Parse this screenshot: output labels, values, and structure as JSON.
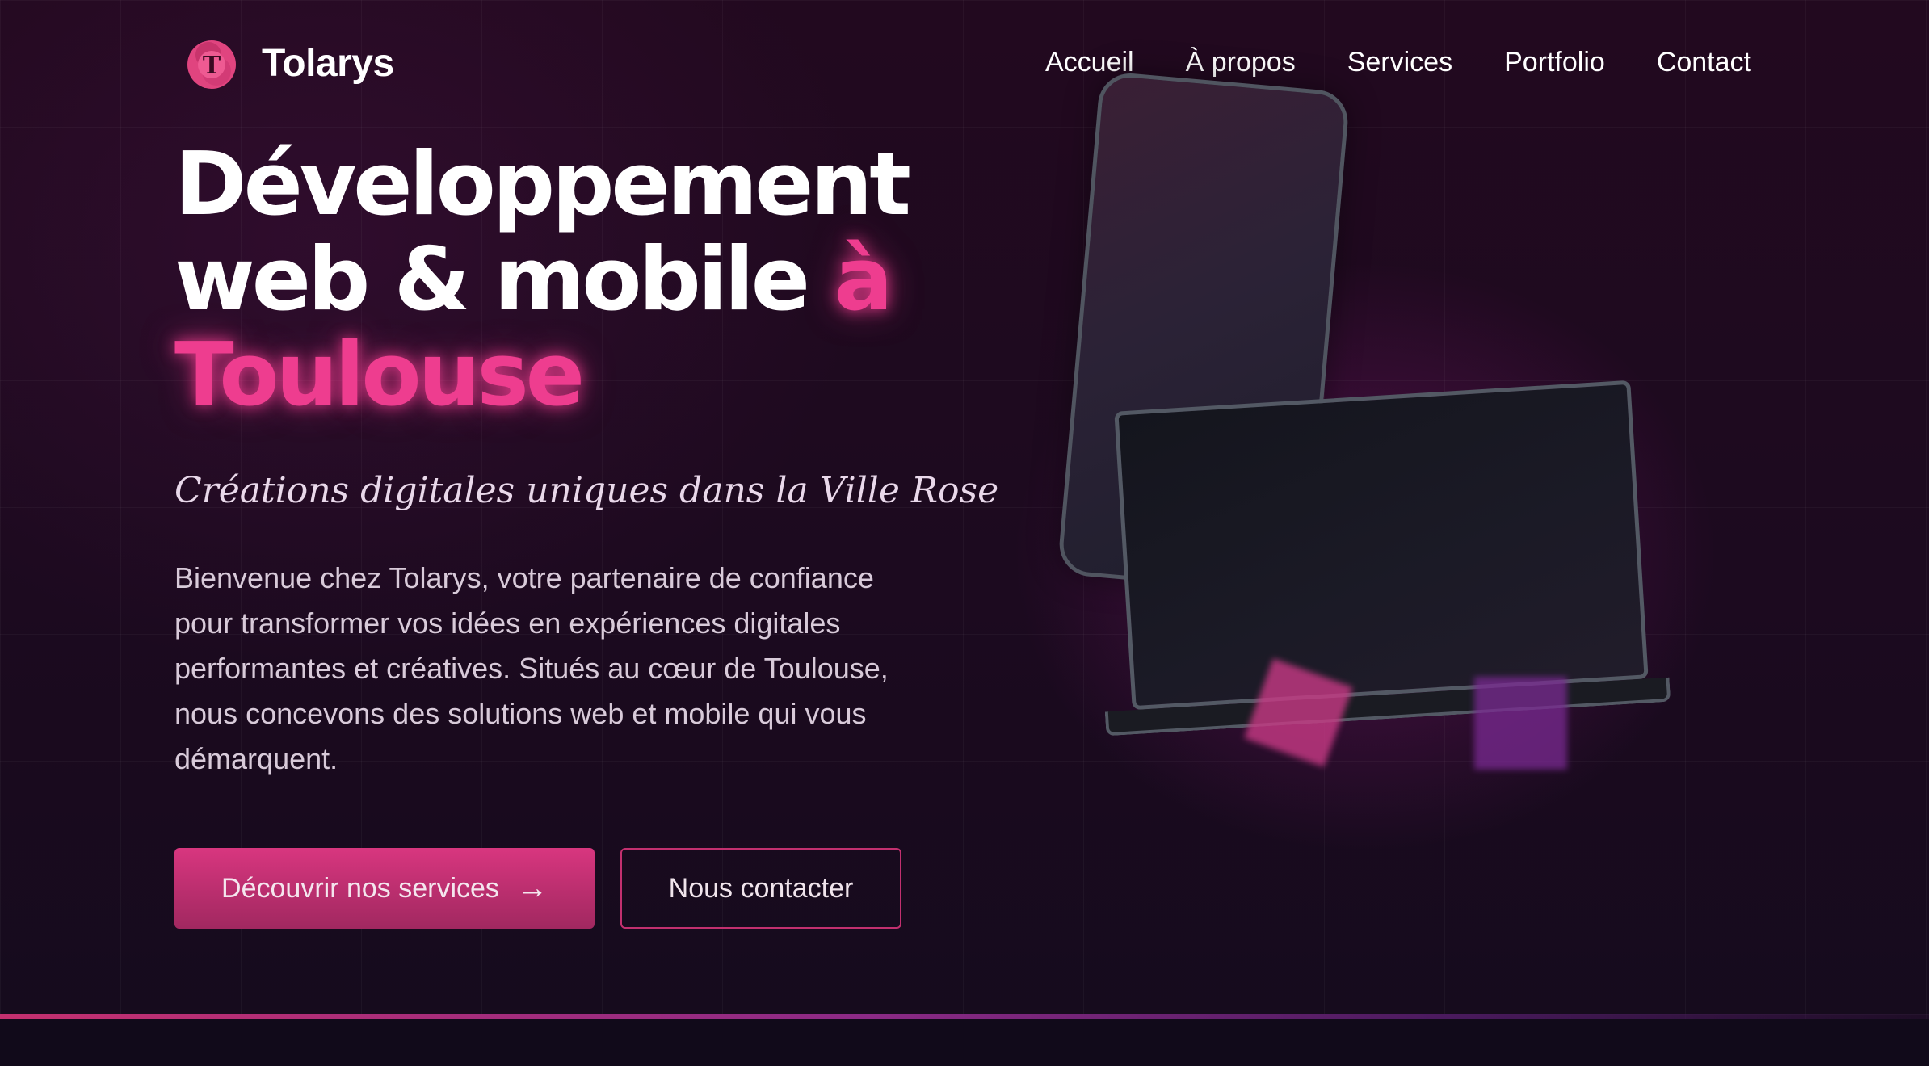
{
  "brand": {
    "logo_letter": "T",
    "name": "Tolarys",
    "primary_color": "#ee3d8f",
    "background_color": "#1a0a1e"
  },
  "nav": {
    "items": [
      {
        "label": "Accueil"
      },
      {
        "label": "À propos"
      },
      {
        "label": "Services"
      },
      {
        "label": "Portfolio"
      },
      {
        "label": "Contact"
      }
    ]
  },
  "hero": {
    "title_line1": "Développement",
    "title_line2": "web & mobile",
    "title_accent_a": "à",
    "title_accent_b": "Toulouse",
    "tagline": "Créations digitales uniques dans la Ville Rose",
    "intro": "Bienvenue chez Tolarys, votre partenaire de confiance pour transformer vos idées en expériences digitales performantes et créatives. Situés au cœur de Toulouse, nous concevons des solutions web et mobile qui vous démarquent.",
    "primary_button": "Découvrir nos services",
    "primary_button_icon": "arrow-right-icon",
    "secondary_button": "Nous contacter"
  }
}
